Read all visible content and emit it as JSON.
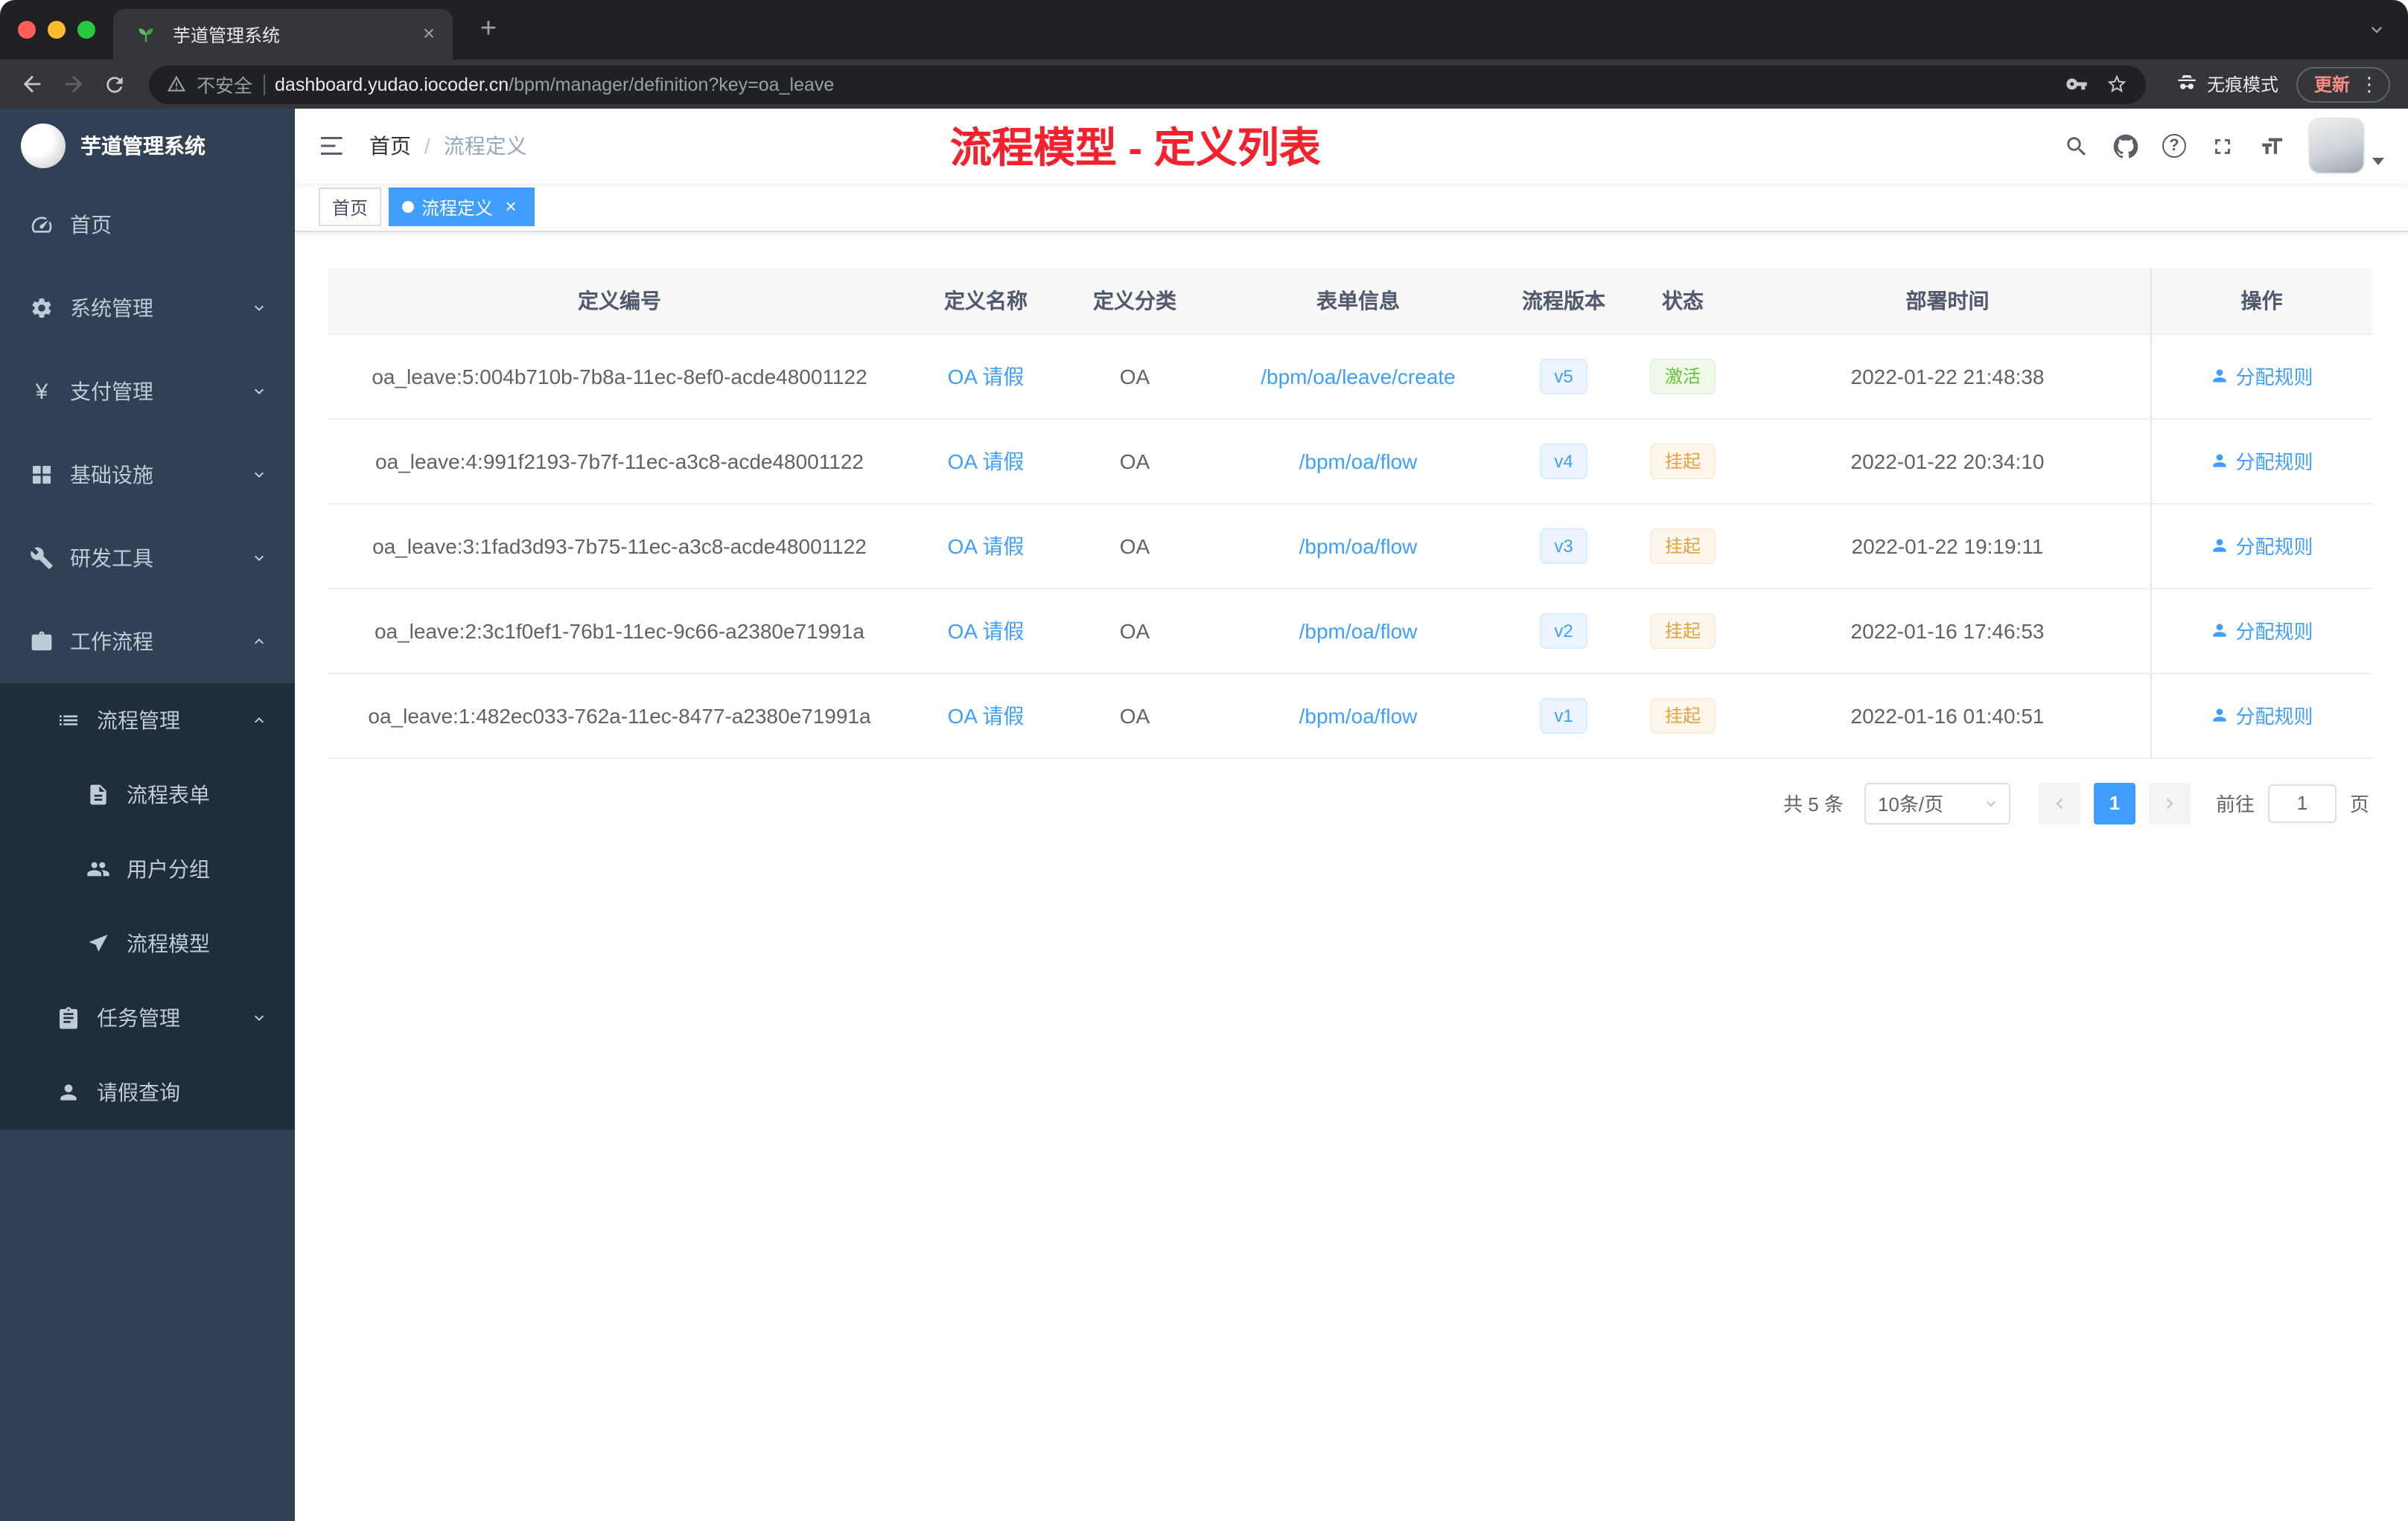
{
  "browser": {
    "tab_title": "芋道管理系统",
    "security_label": "不安全",
    "url_host": "dashboard.yudao.iocoder.cn",
    "url_path": "/bpm/manager/definition?key=oa_leave",
    "incognito_label": "无痕模式",
    "update_label": "更新"
  },
  "sidebar": {
    "logo_title": "芋道管理系统",
    "menu": [
      {
        "label": "首页",
        "icon": "dashboard-icon"
      },
      {
        "label": "系统管理",
        "icon": "gear-icon",
        "expanded": false
      },
      {
        "label": "支付管理",
        "icon": "yen-icon",
        "expanded": false
      },
      {
        "label": "基础设施",
        "icon": "grid-icon",
        "expanded": false
      },
      {
        "label": "研发工具",
        "icon": "wrench-icon",
        "expanded": false
      },
      {
        "label": "工作流程",
        "icon": "briefcase-icon",
        "expanded": true,
        "children": [
          {
            "label": "流程管理",
            "icon": "list-icon",
            "expanded": true,
            "children": [
              {
                "label": "流程表单",
                "icon": "document-icon"
              },
              {
                "label": "用户分组",
                "icon": "users-icon"
              },
              {
                "label": "流程模型",
                "icon": "paper-plane-icon"
              }
            ]
          },
          {
            "label": "任务管理",
            "icon": "clipboard-icon",
            "expanded": false
          },
          {
            "label": "请假查询",
            "icon": "user-icon"
          }
        ]
      }
    ]
  },
  "header": {
    "breadcrumb": [
      "首页",
      "流程定义"
    ],
    "annotation": "流程模型 - 定义列表"
  },
  "tags": [
    {
      "label": "首页",
      "active": false
    },
    {
      "label": "流程定义",
      "active": true
    }
  ],
  "table": {
    "columns": [
      "定义编号",
      "定义名称",
      "定义分类",
      "表单信息",
      "流程版本",
      "状态",
      "部署时间",
      "操作"
    ],
    "rows": [
      {
        "id": "oa_leave:5:004b710b-7b8a-11ec-8ef0-acde48001122",
        "name": "OA 请假",
        "category": "OA",
        "form": "/bpm/oa/leave/create",
        "version": "v5",
        "status": "激活",
        "status_type": "success",
        "deployed_at": "2022-01-22 21:48:38",
        "action": "分配规则"
      },
      {
        "id": "oa_leave:4:991f2193-7b7f-11ec-a3c8-acde48001122",
        "name": "OA 请假",
        "category": "OA",
        "form": "/bpm/oa/flow",
        "version": "v4",
        "status": "挂起",
        "status_type": "warning",
        "deployed_at": "2022-01-22 20:34:10",
        "action": "分配规则"
      },
      {
        "id": "oa_leave:3:1fad3d93-7b75-11ec-a3c8-acde48001122",
        "name": "OA 请假",
        "category": "OA",
        "form": "/bpm/oa/flow",
        "version": "v3",
        "status": "挂起",
        "status_type": "warning",
        "deployed_at": "2022-01-22 19:19:11",
        "action": "分配规则"
      },
      {
        "id": "oa_leave:2:3c1f0ef1-76b1-11ec-9c66-a2380e71991a",
        "name": "OA 请假",
        "category": "OA",
        "form": "/bpm/oa/flow",
        "version": "v2",
        "status": "挂起",
        "status_type": "warning",
        "deployed_at": "2022-01-16 17:46:53",
        "action": "分配规则"
      },
      {
        "id": "oa_leave:1:482ec033-762a-11ec-8477-a2380e71991a",
        "name": "OA 请假",
        "category": "OA",
        "form": "/bpm/oa/flow",
        "version": "v1",
        "status": "挂起",
        "status_type": "warning",
        "deployed_at": "2022-01-16 01:40:51",
        "action": "分配规则"
      }
    ]
  },
  "pagination": {
    "total": "共 5 条",
    "page_size": "10条/页",
    "current_page": "1",
    "goto_label": "前往",
    "goto_value": "1",
    "unit": "页"
  },
  "colors": {
    "primary": "#409EFF",
    "annotation_red": "#F5222D",
    "status_active_green": "#67C23A",
    "status_suspended_orange": "#E6A23C",
    "sidebar_bg": "#304156",
    "submenu_bg": "#1F2D3D"
  }
}
